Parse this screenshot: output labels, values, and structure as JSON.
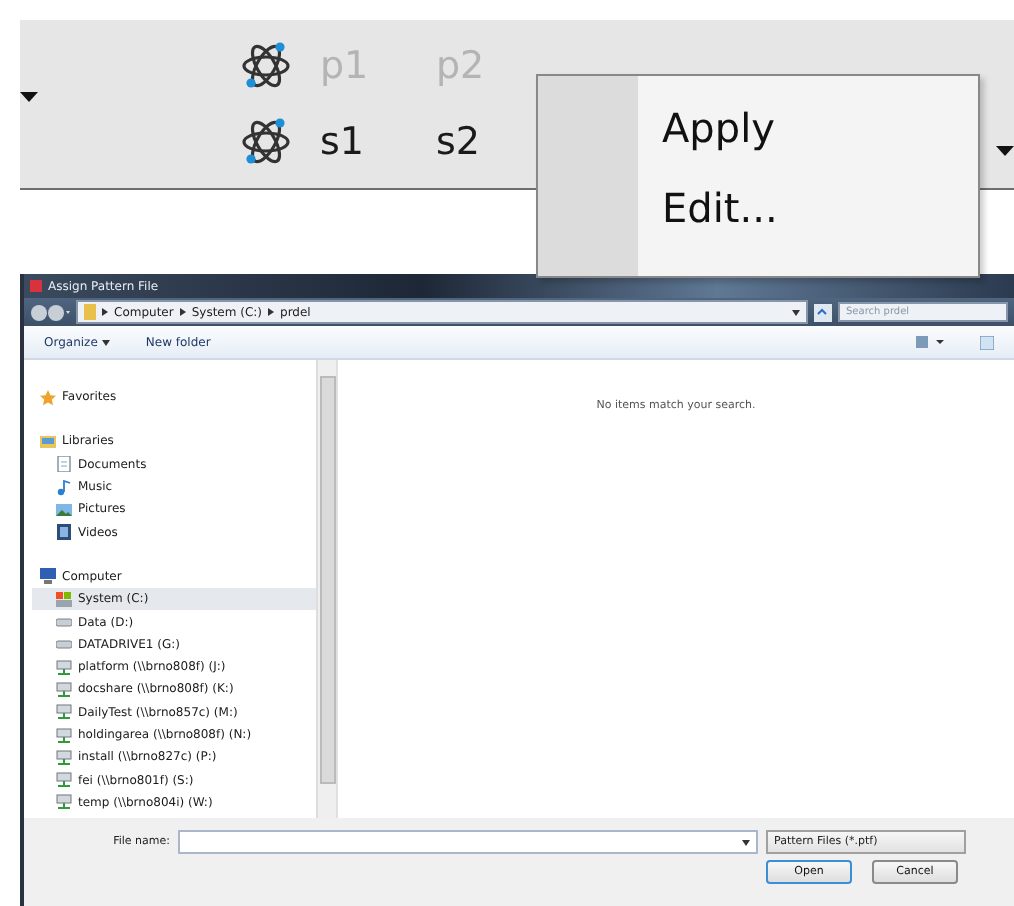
{
  "toolbar": {
    "rows": [
      {
        "enabled": false,
        "items": [
          "p1",
          "p2"
        ]
      },
      {
        "enabled": true,
        "items": [
          "s1",
          "s2"
        ]
      }
    ]
  },
  "context_menu": {
    "items": [
      "Apply",
      "Edit..."
    ]
  },
  "dialog": {
    "title": "Assign Pattern File",
    "breadcrumb": [
      "Computer",
      "System (C:)",
      "prdel"
    ],
    "search": {
      "placeholder": "Search prdel"
    },
    "commands": [
      {
        "label": "Organize",
        "dropdown": true
      },
      {
        "label": "New folder",
        "dropdown": false
      }
    ],
    "navigation": [
      {
        "label": "Favorites",
        "kind": "star",
        "selected": false
      },
      {
        "label": "Libraries",
        "kind": "library",
        "selected": false,
        "children": [
          {
            "label": "Documents",
            "kind": "document",
            "selected": false
          },
          {
            "label": "Music",
            "kind": "music",
            "selected": false
          },
          {
            "label": "Pictures",
            "kind": "picture",
            "selected": false
          },
          {
            "label": "Videos",
            "kind": "video",
            "selected": false
          }
        ]
      },
      {
        "label": "Computer",
        "kind": "computer",
        "selected": false,
        "children": [
          {
            "label": "System (C:)",
            "kind": "system",
            "selected": true
          },
          {
            "label": "Data (D:)",
            "kind": "drive",
            "selected": false
          },
          {
            "label": "DATADRIVE1 (G:)",
            "kind": "drive",
            "selected": false
          },
          {
            "label": "platform (\\\\brno808f) (J:)",
            "kind": "network",
            "selected": false
          },
          {
            "label": "docshare (\\\\brno808f) (K:)",
            "kind": "network",
            "selected": false
          },
          {
            "label": "DailyTest (\\\\brno857c) (M:)",
            "kind": "network",
            "selected": false
          },
          {
            "label": "holdingarea (\\\\brno808f) (N:)",
            "kind": "network",
            "selected": false
          },
          {
            "label": "install (\\\\brno827c) (P:)",
            "kind": "network",
            "selected": false
          },
          {
            "label": "fei (\\\\brno801f) (S:)",
            "kind": "network",
            "selected": false
          },
          {
            "label": "temp (\\\\brno804i) (W:)",
            "kind": "network",
            "selected": false
          }
        ]
      }
    ],
    "empty_message": "No items match your search.",
    "file_name_label": "File name:",
    "file_type": "Pattern Files (*.ptf)",
    "buttons": [
      {
        "label": "Open",
        "default": true
      },
      {
        "label": "Cancel",
        "default": false
      }
    ]
  }
}
